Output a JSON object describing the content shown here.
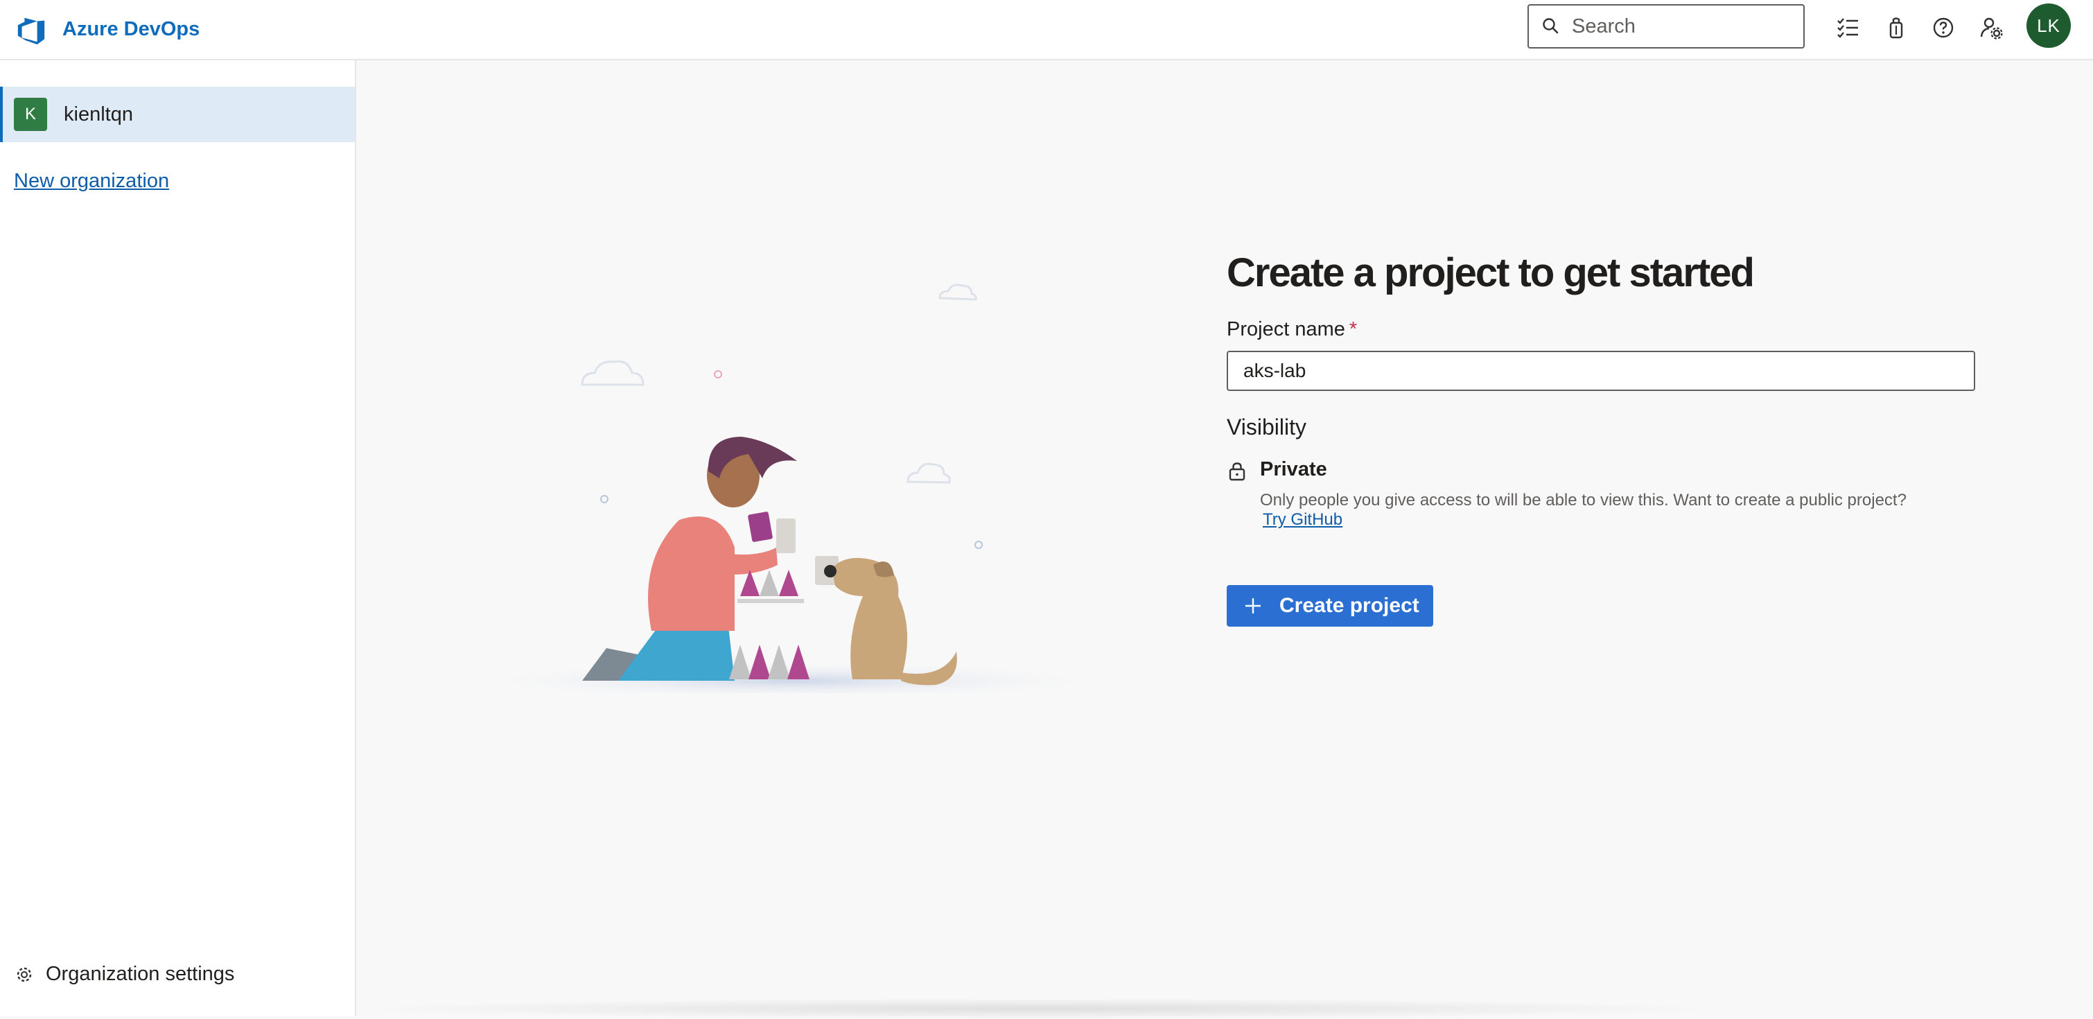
{
  "header": {
    "brand_name": "Azure DevOps",
    "search_placeholder": "Search",
    "avatar_initials": "LK",
    "icons": [
      "work-items-icon",
      "marketplace-icon",
      "help-icon",
      "user-settings-icon"
    ]
  },
  "sidebar": {
    "org": {
      "initial": "K",
      "name": "kienltqn"
    },
    "new_org_label": "New organization",
    "settings_label": "Organization settings"
  },
  "main": {
    "title": "Create a project to get started",
    "project_name_label": "Project name",
    "required_marker": "*",
    "project_name_value": "aks-lab",
    "visibility_heading": "Visibility",
    "visibility_option": "Private",
    "visibility_desc": "Only people you give access to will be able to view this. Want to create a public project?",
    "visibility_link": "Try GitHub",
    "create_button_label": "Create project"
  },
  "colors": {
    "brand": "#0f6cbd",
    "primary_button": "#2b6fd2",
    "avatar": "#1e5b2f",
    "selected_org_bg": "#dfeaf7"
  }
}
